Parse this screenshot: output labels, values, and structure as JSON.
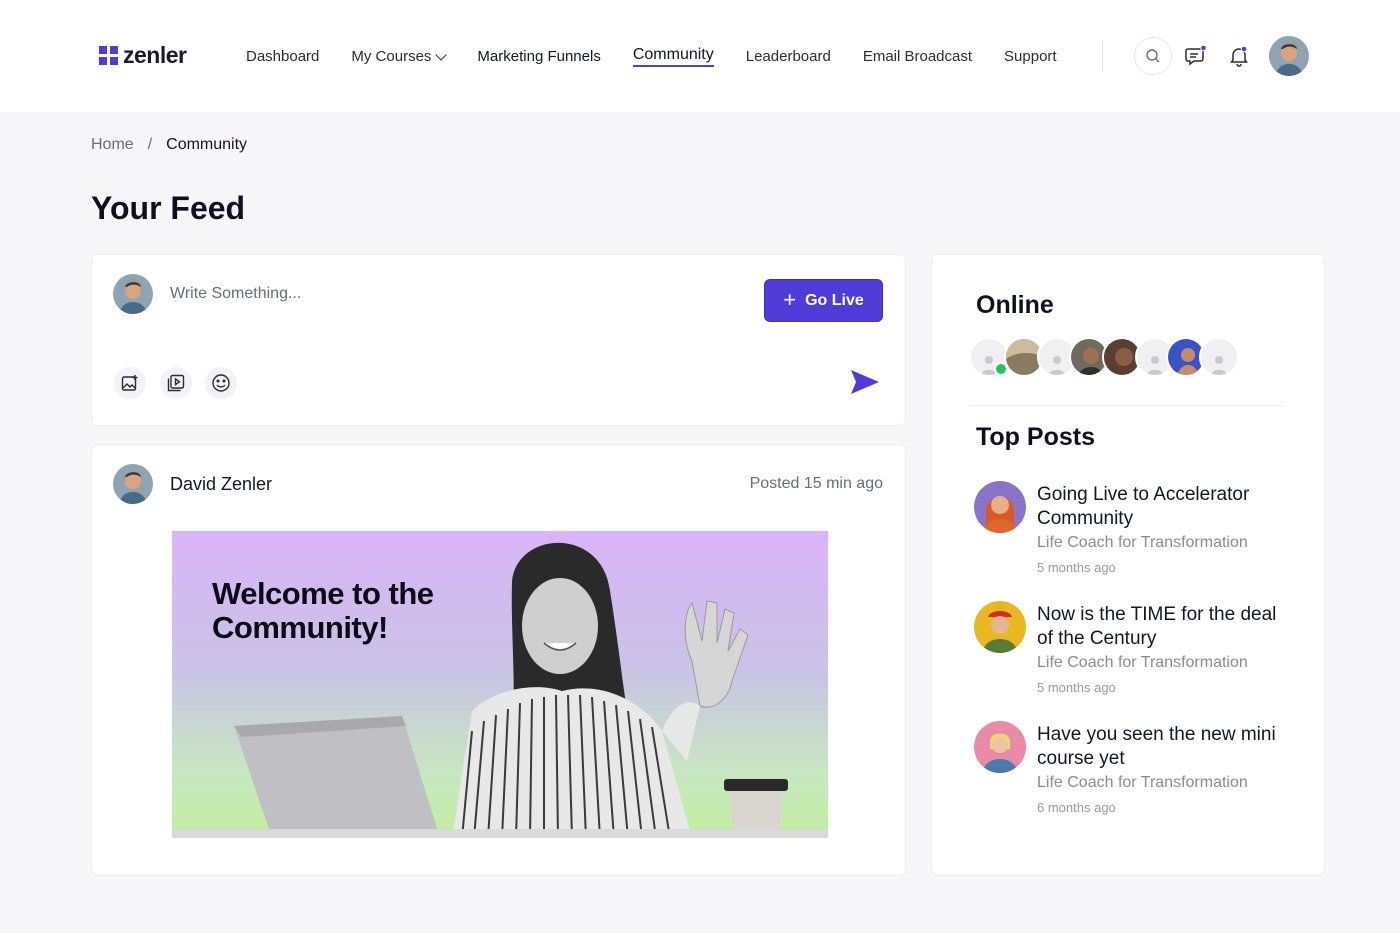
{
  "brand": {
    "name": "zenler",
    "accent": "#4f3bd8"
  },
  "nav": {
    "items": [
      {
        "label": "Dashboard"
      },
      {
        "label": "My Courses"
      },
      {
        "label": "Marketing Funnels"
      },
      {
        "label": "Community"
      },
      {
        "label": "Leaderboard"
      },
      {
        "label": "Email Broadcast"
      },
      {
        "label": "Support"
      }
    ],
    "active": "Community"
  },
  "header_icons": [
    "search-icon",
    "chat-icon",
    "bell-icon",
    "user-avatar"
  ],
  "breadcrumb": {
    "home": "Home",
    "separator": "/",
    "current": "Community"
  },
  "page": {
    "title": "Your Feed"
  },
  "composer": {
    "placeholder": "Write Something...",
    "go_live_label": "Go Live",
    "tools": [
      "image-upload-icon",
      "video-upload-icon",
      "emoji-icon"
    ],
    "send_icon": "send-icon"
  },
  "post": {
    "author": "David Zenler",
    "posted": "Posted 15 min ago",
    "banner_text": "Welcome to the Community!"
  },
  "sidebar": {
    "online_heading": "Online",
    "top_posts_heading": "Top Posts",
    "top_posts": [
      {
        "title": "Going Live to Accelerator Community",
        "subtitle": "Life Coach for Transformation",
        "time": "5 months ago"
      },
      {
        "title": "Now is the TIME for the deal of the Century",
        "subtitle": "Life Coach for Transformation",
        "time": "5 months ago"
      },
      {
        "title": "Have you seen the new mini course yet",
        "subtitle": "Life Coach for Transformation",
        "time": "6 months ago"
      }
    ]
  }
}
